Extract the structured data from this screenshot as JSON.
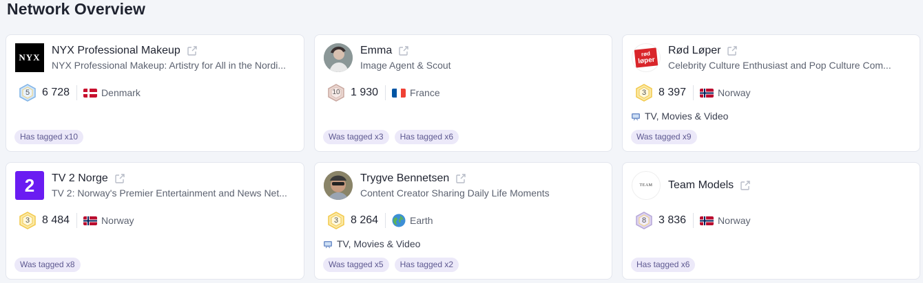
{
  "page": {
    "title": "Network Overview"
  },
  "cards": [
    {
      "name": "NYX Professional Makeup",
      "subtitle": "NYX Professional Makeup: Artistry for All in the Nordi...",
      "level": "5",
      "count": "6 728",
      "country": "Denmark",
      "category": "",
      "tags": [
        "Has tagged x10"
      ],
      "avatar": "nyx-logo"
    },
    {
      "name": "Emma",
      "subtitle": "Image Agent & Scout",
      "level": "10",
      "count": "1 930",
      "country": "France",
      "category": "",
      "tags": [
        "Was tagged x3",
        "Has tagged x6"
      ],
      "avatar": "person-photo"
    },
    {
      "name": "Rød Løper",
      "subtitle": "Celebrity Culture Enthusiast and Pop Culture Com...",
      "level": "3",
      "count": "8 397",
      "country": "Norway",
      "category": "TV, Movies & Video",
      "tags": [
        "Was tagged x9"
      ],
      "avatar": "rod-loper-logo"
    },
    {
      "name": "TV 2 Norge",
      "subtitle": "TV 2: Norway's Premier Entertainment and News Net...",
      "level": "3",
      "count": "8 484",
      "country": "Norway",
      "category": "",
      "tags": [
        "Was tagged x8"
      ],
      "avatar": "tv2-logo"
    },
    {
      "name": "Trygve Bennetsen",
      "subtitle": "Content Creator Sharing Daily Life Moments",
      "level": "3",
      "count": "8 264",
      "country": "Earth",
      "category": "TV, Movies & Video",
      "tags": [
        "Was tagged x5",
        "Has tagged x2"
      ],
      "avatar": "person-photo"
    },
    {
      "name": "Team Models",
      "subtitle": "",
      "level": "8",
      "count": "3 836",
      "country": "Norway",
      "category": "",
      "tags": [
        "Has tagged x6"
      ],
      "avatar": "team-models-logo"
    }
  ],
  "logo_text": {
    "nyx": "NYX",
    "rod_loper_1": "rød",
    "rod_loper_2": "løper",
    "tv2": "2",
    "team_models": "TEAM"
  },
  "colors": {
    "tag_bg": "#ece9f9",
    "tag_text": "#5d5890",
    "level_3": "#f2c94c",
    "level_5": "#7fb3e6",
    "level_8": "#b6a7d8",
    "level_10": "#c9a8a0",
    "tv2_purple": "#6a1cf2",
    "rod_loper_red": "#d9252a"
  }
}
